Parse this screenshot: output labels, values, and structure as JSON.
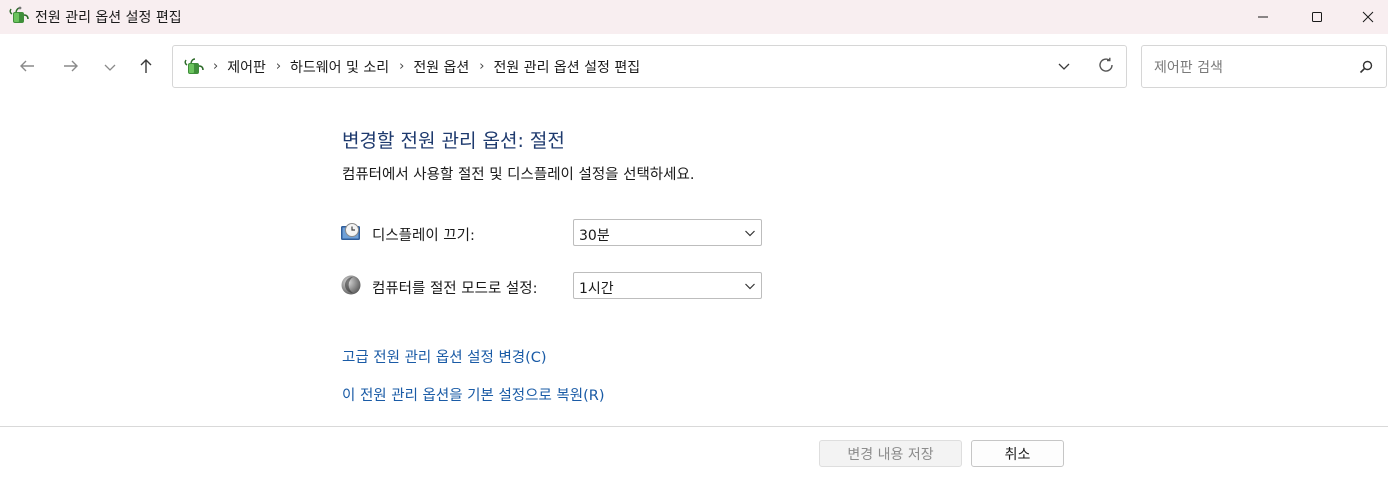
{
  "window": {
    "title": "전원 관리 옵션 설정 편집",
    "icon": "power-options-icon"
  },
  "window_controls": {
    "minimize": "minimize-icon",
    "maximize": "maximize-icon",
    "close": "close-icon"
  },
  "nav": {
    "back": "back-arrow-icon",
    "forward": "forward-arrow-icon",
    "recent": "chevron-down-icon",
    "up": "up-arrow-icon"
  },
  "address": {
    "crumbs": [
      "제어판",
      "하드웨어 및 소리",
      "전원 옵션",
      "전원 관리 옵션 설정 편집"
    ],
    "separator": "›"
  },
  "search": {
    "placeholder": "제어판 검색",
    "value": ""
  },
  "main": {
    "heading": "변경할 전원 관리 옵션: 절전",
    "subheading": "컴퓨터에서 사용할 절전 및 디스플레이 설정을 선택하세요.",
    "settings": [
      {
        "label": "디스플레이 끄기:",
        "value": "30분",
        "icon": "display-clock-icon"
      },
      {
        "label": "컴퓨터를 절전 모드로 설정:",
        "value": "1시간",
        "icon": "sleep-moon-icon"
      }
    ],
    "links": {
      "advanced": "고급 전원 관리 옵션 설정 변경(C)",
      "restore": "이 전원 관리 옵션을 기본 설정으로 복원(R)"
    }
  },
  "footer": {
    "save_label": "변경 내용 저장",
    "cancel_label": "취소"
  },
  "colors": {
    "titlebar_bg": "#f8eef0",
    "heading": "#1e3a6e",
    "link": "#1a5ba6",
    "disabled_text": "#8c8c8c"
  }
}
